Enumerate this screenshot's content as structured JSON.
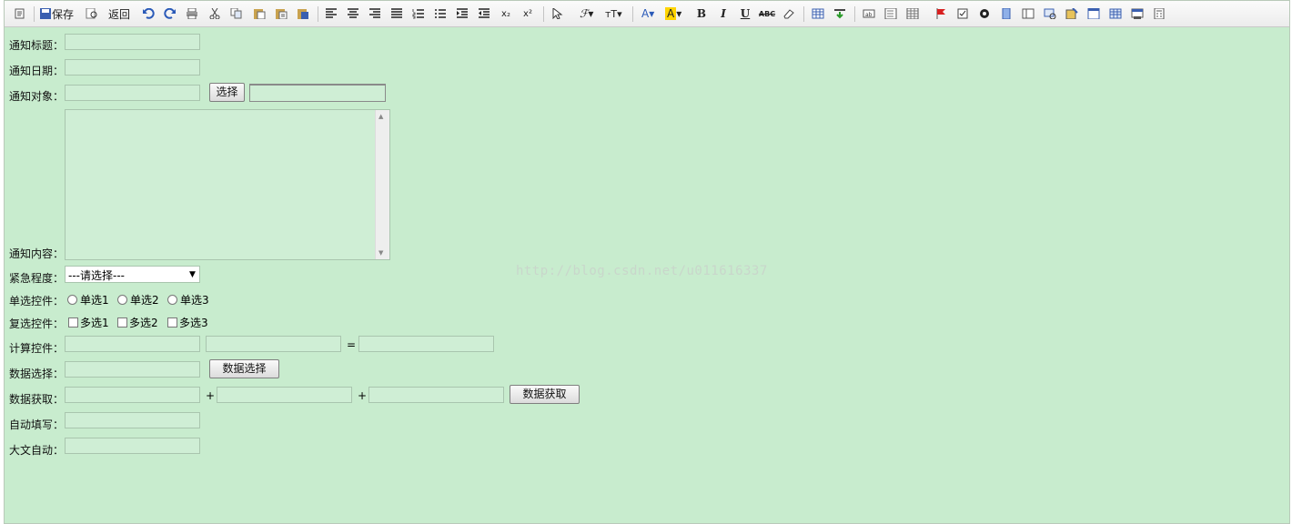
{
  "toolbar": {
    "save_label": "保存",
    "back_label": "返回",
    "icons": [
      "source-icon",
      "save-icon",
      "preview-icon",
      "undo-icon",
      "redo-icon",
      "print-icon",
      "cut-icon",
      "copy-icon",
      "paste-icon",
      "paste-text-icon",
      "paste-word-icon",
      "align-left-icon",
      "align-center-icon",
      "align-right-icon",
      "justify-icon",
      "ordered-list-icon",
      "unordered-list-icon",
      "indent-icon",
      "outdent-icon",
      "subscript-icon",
      "superscript-icon",
      "select-icon",
      "font-family-icon",
      "font-size-icon",
      "font-color-icon",
      "highlight-icon",
      "bold-icon",
      "italic-icon",
      "underline-icon",
      "strikethrough-icon",
      "eraser-icon",
      "table-icon",
      "insert-row-icon",
      "textfield-icon",
      "textarea-icon",
      "grid-icon",
      "flag-icon",
      "checkbox-icon",
      "macro-icon",
      "list-icon",
      "column-icon",
      "comment-icon",
      "image-icon",
      "form-icon",
      "data-table-icon",
      "window-icon",
      "calc-icon"
    ]
  },
  "form": {
    "title_label": "通知标题：",
    "date_label": "通知日期：",
    "target_label": "通知对象：",
    "select_button": "选择",
    "content_label": "通知内容：",
    "urgency_label": "紧急程度：",
    "urgency_value": "---请选择---",
    "radio_label": "单选控件：",
    "radio_options": [
      "单选1",
      "单选2",
      "单选3"
    ],
    "checkbox_label": "复选控件：",
    "checkbox_options": [
      "多选1",
      "多选2",
      "多选3"
    ],
    "calc_label": "计算控件：",
    "equals": "=",
    "data_select_label": "数据选择：",
    "data_select_button": "数据选择",
    "data_fetch_label": "数据获取：",
    "plus": "+",
    "data_fetch_button": "数据获取",
    "autofill_label": "自动填写：",
    "bigtext_label": "大文自动："
  },
  "watermark": "http://blog.csdn.net/u011616337",
  "colors": {
    "background": "#c8ecce",
    "input": "#cfeed5"
  }
}
